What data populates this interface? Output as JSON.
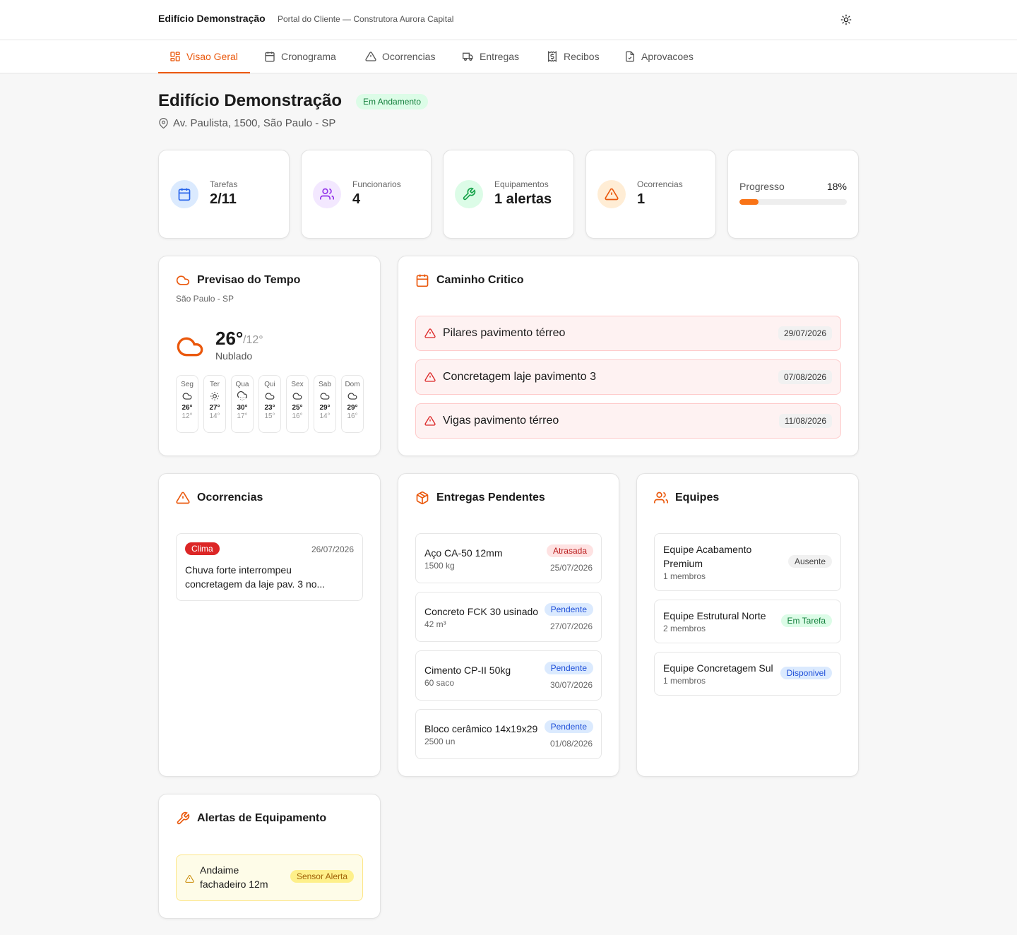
{
  "header": {
    "brand": "Edifício Demonstração",
    "subtitle": "Portal do Cliente — Construtora Aurora Capital"
  },
  "tabs": [
    {
      "label": "Visao Geral",
      "icon": "grid-icon",
      "active": true
    },
    {
      "label": "Cronograma",
      "icon": "calendar-icon"
    },
    {
      "label": "Ocorrencias",
      "icon": "warning-icon"
    },
    {
      "label": "Entregas",
      "icon": "truck-icon"
    },
    {
      "label": "Recibos",
      "icon": "receipt-icon"
    },
    {
      "label": "Aprovacoes",
      "icon": "file-check-icon"
    }
  ],
  "project": {
    "title": "Edifício Demonstração",
    "status": "Em Andamento",
    "address": "Av. Paulista, 1500, São Paulo - SP"
  },
  "stats": {
    "tarefas": {
      "label": "Tarefas",
      "value": "2/11"
    },
    "funcionarios": {
      "label": "Funcionarios",
      "value": "4"
    },
    "equipamentos": {
      "label": "Equipamentos",
      "value": "1 alertas"
    },
    "ocorrencias": {
      "label": "Ocorrencias",
      "value": "1"
    },
    "progresso": {
      "label": "Progresso",
      "value_text": "18%",
      "value": 0.18
    }
  },
  "weather": {
    "title": "Previsao do Tempo",
    "location": "São Paulo - SP",
    "temp": "26°",
    "low": "/12°",
    "condition": "Nublado",
    "days": [
      {
        "day": "Seg",
        "hi": "26°",
        "lo": "12°",
        "icon": "cloud-icon"
      },
      {
        "day": "Ter",
        "hi": "27°",
        "lo": "14°",
        "icon": "sun-icon"
      },
      {
        "day": "Qua",
        "hi": "30°",
        "lo": "17°",
        "icon": "cloud-drizzle-icon"
      },
      {
        "day": "Qui",
        "hi": "23°",
        "lo": "15°",
        "icon": "cloud-icon"
      },
      {
        "day": "Sex",
        "hi": "25°",
        "lo": "16°",
        "icon": "cloud-icon"
      },
      {
        "day": "Sab",
        "hi": "29°",
        "lo": "14°",
        "icon": "cloud-icon"
      },
      {
        "day": "Dom",
        "hi": "29°",
        "lo": "16°",
        "icon": "cloud-icon"
      }
    ]
  },
  "critical": {
    "title": "Caminho Critico",
    "items": [
      {
        "name": "Pilares pavimento térreo",
        "date": "29/07/2026"
      },
      {
        "name": "Concretagem laje pavimento 3",
        "date": "07/08/2026"
      },
      {
        "name": "Vigas pavimento térreo",
        "date": "11/08/2026"
      }
    ]
  },
  "occurrences": {
    "title": "Ocorrencias",
    "items": [
      {
        "tag": "Clima",
        "date": "26/07/2026",
        "text1": "Chuva forte interrompeu",
        "text2": "concretagem da laje pav. 3 no..."
      }
    ]
  },
  "deliveries": {
    "title": "Entregas Pendentes",
    "items": [
      {
        "name": "Aço CA-50 12mm",
        "qty": "1500 kg",
        "status": "Atrasada",
        "date": "25/07/2026"
      },
      {
        "name": "Concreto FCK 30 usinado",
        "qty": "42 m³",
        "status": "Pendente",
        "date": "27/07/2026"
      },
      {
        "name": "Cimento CP-II 50kg",
        "qty": "60 saco",
        "status": "Pendente",
        "date": "30/07/2026"
      },
      {
        "name": "Bloco cerâmico 14x19x29",
        "qty": "2500 un",
        "status": "Pendente",
        "date": "01/08/2026"
      }
    ]
  },
  "teams": {
    "title": "Equipes",
    "items": [
      {
        "name1": "Equipe Acabamento",
        "name2": "Premium",
        "members": "1 membros",
        "status": "Ausente"
      },
      {
        "name1": "Equipe Estrutural Norte",
        "members": "2 membros",
        "status": "Em Tarefa"
      },
      {
        "name1": "Equipe Concretagem Sul",
        "members": "1 membros",
        "status": "Disponivel"
      }
    ]
  },
  "equipment_alerts": {
    "title": "Alertas de Equipamento",
    "items": [
      {
        "name1": "Andaime",
        "name2": "fachadeiro 12m",
        "status": "Sensor Alerta"
      }
    ]
  },
  "colors": {
    "accent": "#ea580c",
    "danger": "#dc2626",
    "progress": "#f97316"
  }
}
